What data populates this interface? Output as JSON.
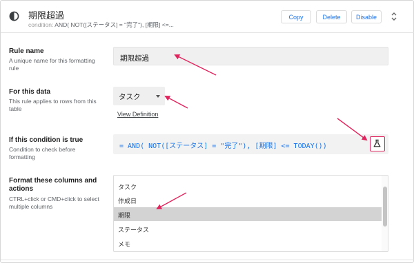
{
  "header": {
    "icon": "contrast-icon",
    "title": "期限超過",
    "condition_prefix": "condition:",
    "condition_text": "AND( NOT([ステータス] = \"完了\"), [期限] <=...",
    "buttons": {
      "copy": "Copy",
      "delete": "Delete",
      "disable": "Disable"
    },
    "sort_icon": "unfold-icon"
  },
  "rule_name": {
    "title": "Rule name",
    "description": "A unique name for this formatting rule",
    "value": "期限超過"
  },
  "for_this_data": {
    "title": "For this data",
    "description": "This rule applies to rows from this table",
    "selected": "タスク",
    "view_definition": "View Definition"
  },
  "condition": {
    "title": "If this condition is true",
    "description": "Condition to check before formatting",
    "formula": "= AND( NOT([ステータス] = \"完了\"), [期限] <= TODAY())",
    "test_icon": "flask-icon"
  },
  "format_columns": {
    "title": "Format these columns and actions",
    "description": "CTRL+click or CMD+click to select multiple columns",
    "items": [
      {
        "label": "タスク",
        "selected": false
      },
      {
        "label": "作成日",
        "selected": false
      },
      {
        "label": "期限",
        "selected": true
      },
      {
        "label": "ステータス",
        "selected": false
      },
      {
        "label": "メモ",
        "selected": false
      }
    ]
  },
  "colors": {
    "accent": "#1a73e8",
    "annotation": "#e0245e",
    "selected_row": "#d3d3d3"
  }
}
